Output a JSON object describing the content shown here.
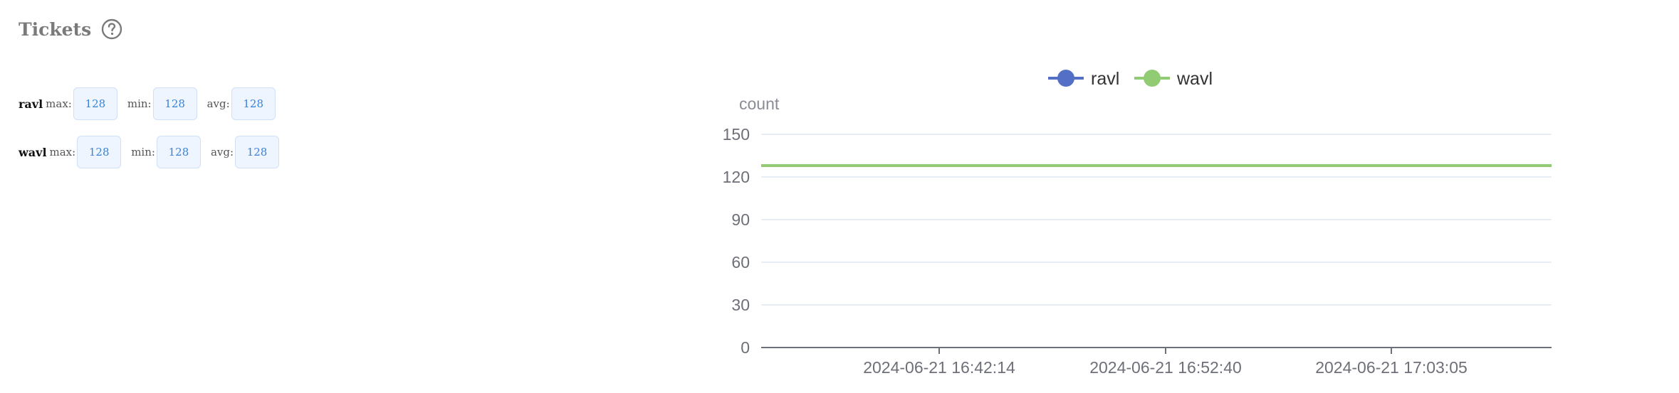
{
  "panel": {
    "title": "Tickets",
    "help_icon": "question-circle-icon"
  },
  "stats": [
    {
      "name": "ravl",
      "max_label": "max:",
      "max": "128",
      "min_label": "min:",
      "min": "128",
      "avg_label": "avg:",
      "avg": "128"
    },
    {
      "name": "wavl",
      "max_label": "max:",
      "max": "128",
      "min_label": "min:",
      "min": "128",
      "avg_label": "avg:",
      "avg": "128"
    }
  ],
  "colors": {
    "ravl": "#5470c6",
    "wavl": "#91cc75",
    "grid": "#e0e6f1",
    "axis": "#6e7079"
  },
  "chart_data": {
    "type": "line",
    "ylabel": "count",
    "ylim": [
      0,
      150
    ],
    "yticks": [
      0,
      30,
      60,
      90,
      120,
      150
    ],
    "x_tick_labels": [
      "2024-06-21 16:42:14",
      "2024-06-21 16:52:40",
      "2024-06-21 17:03:05"
    ],
    "legend_position": "top-center",
    "grid": true,
    "series": [
      {
        "name": "ravl",
        "values": [
          128,
          128,
          128,
          128
        ],
        "color": "#5470c6"
      },
      {
        "name": "wavl",
        "values": [
          128,
          128,
          128,
          128
        ],
        "color": "#91cc75"
      }
    ]
  }
}
